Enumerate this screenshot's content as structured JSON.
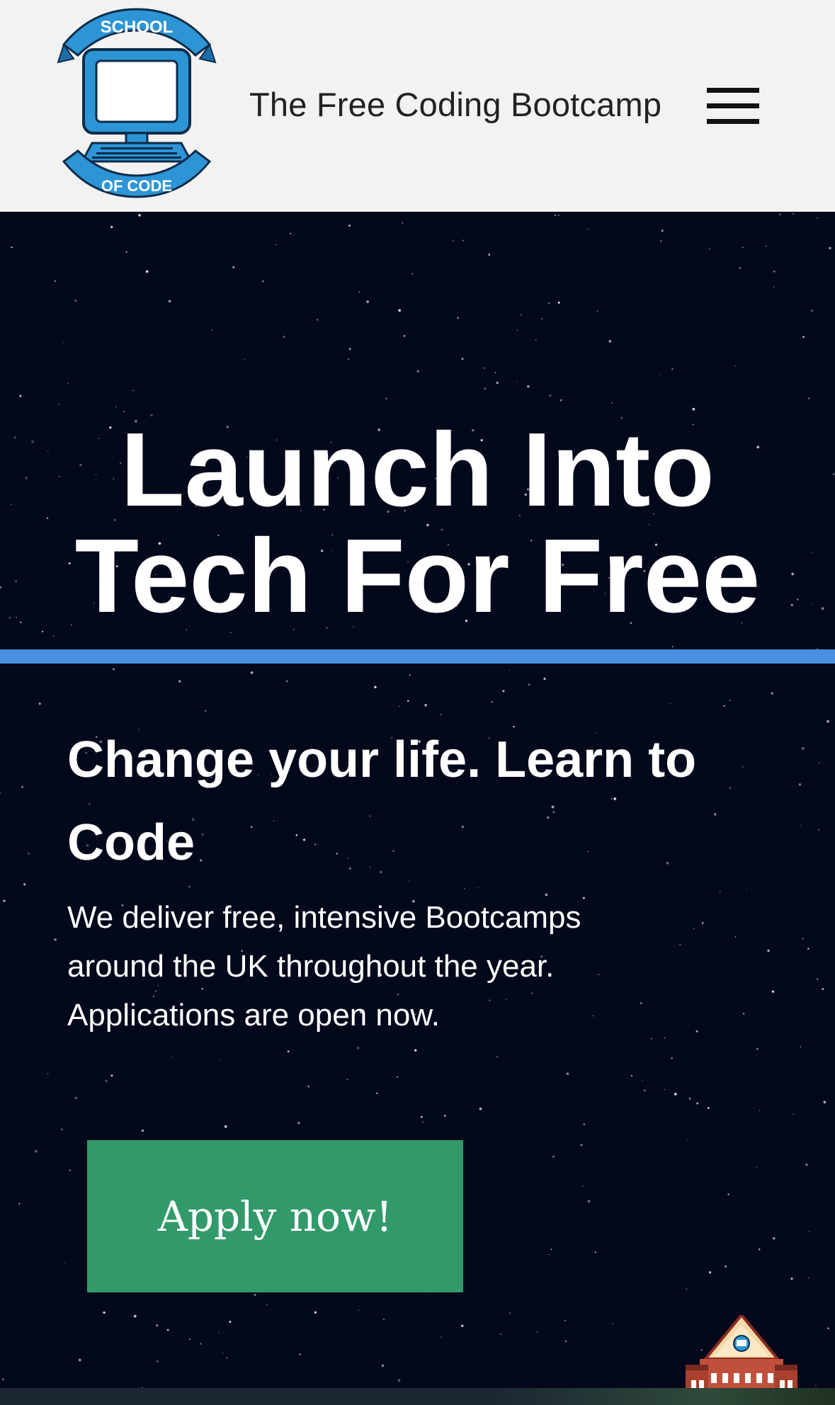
{
  "header": {
    "logo": {
      "top_text": "SCHOOL",
      "bottom_text": "OF CODE"
    },
    "tagline": "The Free Coding Bootcamp",
    "menu_icon": "hamburger-menu-icon"
  },
  "hero": {
    "headline_line1": "Launch Into",
    "headline_line2": "Tech For Free",
    "subheading": "Change your life. Learn to Code",
    "description": "We deliver free, intensive Bootcamps around the UK throughout the year. Applications are open now.",
    "cta_label": "Apply now!",
    "corner_icon": "school-building-icon"
  },
  "colors": {
    "header_bg": "#f2f2f2",
    "hero_bg": "#03081a",
    "accent_bar": "#4a8fe0",
    "cta_bg": "#329a6a",
    "logo_blue": "#2d95d6"
  }
}
